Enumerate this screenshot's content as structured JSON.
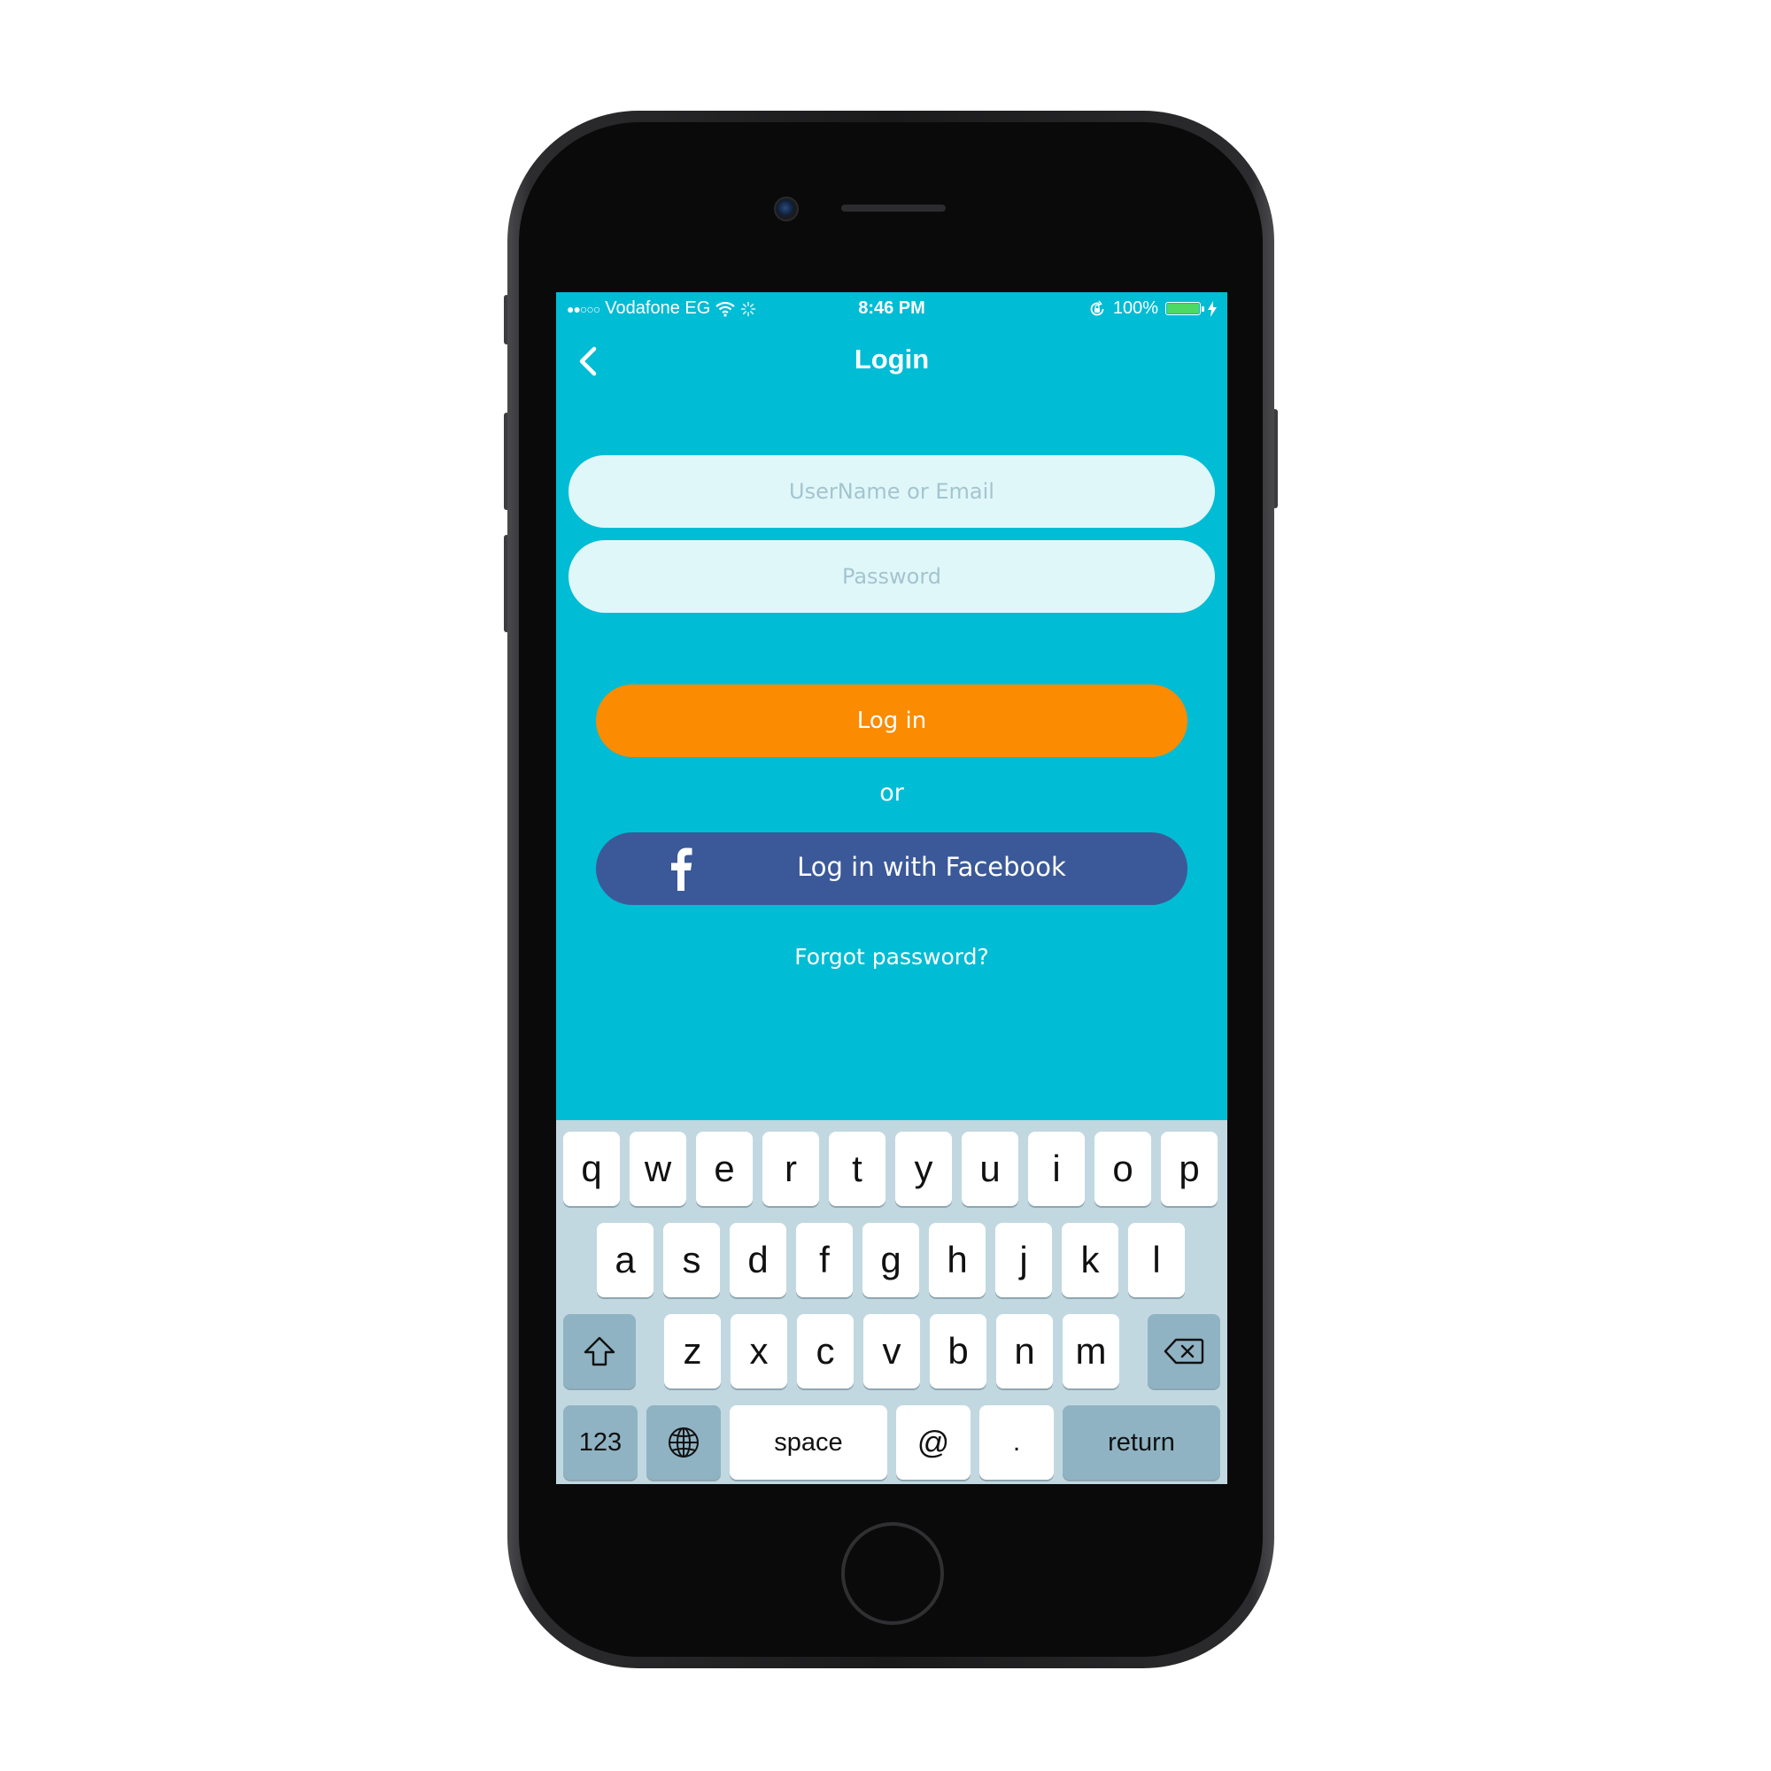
{
  "status_bar": {
    "signal": "●●○○○",
    "carrier": "Vodafone EG",
    "time": "8:46 PM",
    "battery_percent": "100%",
    "battery_level": 1.0,
    "icons": [
      "wifi-icon",
      "activity-spinner-icon",
      "rotation-lock-icon",
      "battery-icon",
      "charging-bolt-icon"
    ]
  },
  "nav": {
    "title": "Login",
    "back_icon": "chevron-left-icon"
  },
  "form": {
    "username_placeholder": "UserName or Email",
    "username_value": "",
    "password_placeholder": "Password",
    "password_value": "",
    "login_label": "Log in",
    "or_label": "or",
    "facebook_label": "Log in with Facebook",
    "facebook_icon": "facebook-f-icon",
    "forgot_label": "Forgot password?"
  },
  "keyboard": {
    "row1": [
      "q",
      "w",
      "e",
      "r",
      "t",
      "y",
      "u",
      "i",
      "o",
      "p"
    ],
    "row2": [
      "a",
      "s",
      "d",
      "f",
      "g",
      "h",
      "j",
      "k",
      "l"
    ],
    "row3": [
      "z",
      "x",
      "c",
      "v",
      "b",
      "n",
      "m"
    ],
    "numbers_label": "123",
    "space_label": "space",
    "at_label": "@",
    "period_label": ".",
    "return_label": "return",
    "shift_icon": "shift-arrow-icon",
    "delete_icon": "backspace-icon",
    "globe_icon": "globe-icon"
  },
  "colors": {
    "background": "#00bcd4",
    "field": "#e0f7fa",
    "login_button": "#fb8b00",
    "facebook_button": "#3b5998",
    "keyboard": "#c2d8e0",
    "function_key": "#8fb3c3",
    "battery_fill": "#4cd964"
  }
}
